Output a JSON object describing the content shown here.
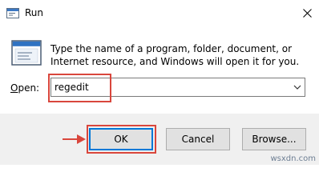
{
  "window": {
    "title": "Run"
  },
  "description": "Type the name of a program, folder, document, or Internet resource, and Windows will open it for you.",
  "open": {
    "label_prefix": "O",
    "label_rest": "pen:",
    "value": "regedit"
  },
  "buttons": {
    "ok": "OK",
    "cancel": "Cancel",
    "browse": "Browse..."
  },
  "watermark": "wsxdn.com",
  "colors": {
    "highlight": "#d9463c",
    "accent": "#0078d7"
  }
}
